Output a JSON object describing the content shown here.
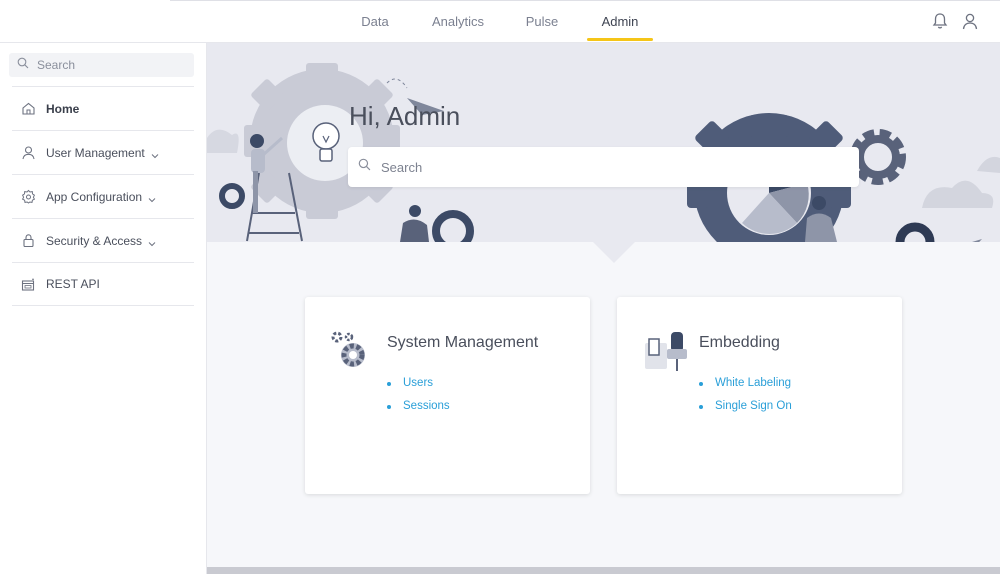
{
  "nav": {
    "tabs": [
      {
        "label": "Data"
      },
      {
        "label": "Analytics"
      },
      {
        "label": "Pulse"
      },
      {
        "label": "Admin",
        "active": true
      }
    ]
  },
  "topbar": {
    "icons": [
      "bell-icon",
      "user-icon"
    ]
  },
  "sidebar": {
    "search_placeholder": "Search",
    "items": [
      {
        "label": "Home",
        "icon": "home-icon"
      },
      {
        "label": "User Management",
        "icon": "user-icon",
        "expandable": true
      },
      {
        "label": "App Configuration",
        "icon": "gear-icon",
        "expandable": true
      },
      {
        "label": "Security & Access",
        "icon": "lock-icon",
        "expandable": true
      },
      {
        "label": "REST API",
        "icon": "api-icon"
      }
    ]
  },
  "hero": {
    "greeting": "Hi, Admin",
    "search_placeholder": "Search"
  },
  "cards": [
    {
      "title": "System Management",
      "icon": "gears-icon",
      "links": [
        "Users",
        "Sessions"
      ]
    },
    {
      "title": "Embedding",
      "icon": "paint-roller-icon",
      "links": [
        "White Labeling",
        "Single Sign On"
      ]
    }
  ],
  "colors": {
    "accent": "#f5c518",
    "link": "#2a9fd8",
    "hero_bg": "#e8e9f0",
    "gear_dark": "#3c4a66"
  }
}
